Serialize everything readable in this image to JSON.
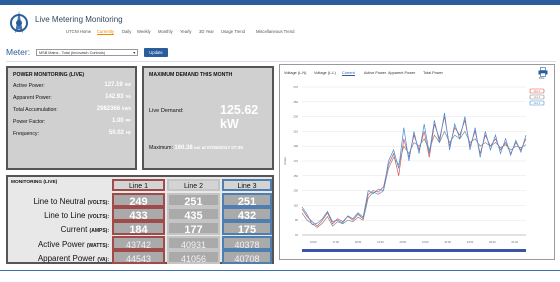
{
  "app": {
    "title": "Live Metering Monitoring"
  },
  "nav": {
    "items": [
      {
        "label": "UTCNI Home",
        "active": false
      },
      {
        "label": "Currently",
        "active": true
      },
      {
        "label": "Daily",
        "active": false
      },
      {
        "label": "Weekly",
        "active": false
      },
      {
        "label": "Monthly",
        "active": false
      },
      {
        "label": "Yearly",
        "active": false
      },
      {
        "label": "3D Year",
        "active": false
      },
      {
        "label": "Usage Trend",
        "active": false
      },
      {
        "label": "Miscellaneous Trend",
        "active": false
      }
    ]
  },
  "meter": {
    "label": "Meter:",
    "selected": "MSB Mains - Total (Innovatch Controls)",
    "update_label": "Update"
  },
  "power_monitoring": {
    "title": "POWER MONITORING (LIVE)",
    "rows": [
      {
        "label": "Active Power:",
        "value": "127.19",
        "unit": "kW"
      },
      {
        "label": "Apparent Power:",
        "value": "142.93",
        "unit": "VA"
      },
      {
        "label": "Total Accumulation:",
        "value": "2982366",
        "unit": "kWh"
      },
      {
        "label": "Power Factor:",
        "value": "1.00",
        "unit": "PF"
      },
      {
        "label": "Frequency:",
        "value": "50.02",
        "unit": "Hz"
      }
    ]
  },
  "max_demand": {
    "title": "MAXIMUM DEMAND THIS MONTH",
    "live_label": "Live Demand:",
    "live_value": "125.62 kW",
    "max_label": "Maximum:",
    "max_value": "160.38",
    "max_unit": "kW",
    "max_at": "at 07/09/2017 07:35"
  },
  "monitoring": {
    "title": "MONITORING (LIVE)",
    "columns": [
      "Line 1",
      "Line 2",
      "Line 3"
    ],
    "rows": [
      {
        "label": "Line to Neutral",
        "unit": "(VOLTS):",
        "values": [
          "249",
          "251",
          "251"
        ]
      },
      {
        "label": "Line to Line",
        "unit": "(VOLTS):",
        "values": [
          "433",
          "435",
          "432"
        ]
      },
      {
        "label": "Current",
        "unit": "(AMPS):",
        "values": [
          "184",
          "177",
          "175"
        ]
      },
      {
        "label": "Active Power",
        "unit": "(WATTS):",
        "values": [
          "43742",
          "40931",
          "40378"
        ]
      },
      {
        "label": "Apparent Power",
        "unit": "(VA):",
        "values": [
          "44543",
          "41056",
          "40708"
        ]
      }
    ]
  },
  "chart_tabs": {
    "items": [
      {
        "label": "Voltage (L-N)",
        "active": false
      },
      {
        "label": "Voltage (L-L)",
        "active": false
      },
      {
        "label": "Current",
        "active": true
      },
      {
        "label": "Active Power",
        "active": false
      },
      {
        "label": "Apparent Power",
        "active": false
      },
      {
        "label": "Total Power",
        "active": false
      }
    ],
    "print_label": "Print"
  },
  "colors": {
    "brand": "#2a5d9c",
    "nav_active": "#f08a00",
    "line1": "#d9534f",
    "line2": "#888888",
    "line3": "#3c8dde"
  },
  "chart_data": {
    "type": "line",
    "ylabel": "Amps",
    "ylim": [
      70,
      270
    ],
    "yticks": [
      "270",
      "250",
      "230",
      "210",
      "190",
      "170",
      "150",
      "130",
      "110",
      "90",
      "70"
    ],
    "xticks": [
      "16:00",
      "17:00",
      "18:00",
      "19:00",
      "20:00",
      "21:00",
      "22:00",
      "23:00",
      "00:00",
      "01:00"
    ],
    "legend": [
      "Line 1",
      "Line 2",
      "Line 3"
    ],
    "legend_placement": "top-right",
    "grid": true,
    "series": [
      {
        "name": "Line 1",
        "values": [
          105,
          95,
          88,
          82,
          90,
          100,
          85,
          92,
          88,
          95,
          90,
          98,
          92,
          125,
          130,
          128,
          135,
          165,
          180,
          150,
          200,
          175,
          205,
          185,
          210,
          175,
          220,
          200,
          230,
          190,
          215,
          205,
          225,
          190,
          210,
          180,
          205,
          190,
          200,
          185,
          195,
          180,
          195,
          185,
          200
        ]
      },
      {
        "name": "Line 2",
        "values": [
          100,
          90,
          85,
          80,
          86,
          95,
          82,
          88,
          85,
          90,
          88,
          94,
          90,
          120,
          128,
          125,
          130,
          160,
          175,
          165,
          190,
          180,
          195,
          190,
          200,
          185,
          205,
          195,
          210,
          195,
          205,
          200,
          210,
          195,
          200,
          190,
          195,
          190,
          195,
          188,
          192,
          185,
          190,
          188,
          192
        ]
      },
      {
        "name": "Line 3",
        "values": [
          108,
          98,
          84,
          86,
          92,
          102,
          88,
          90,
          86,
          96,
          92,
          100,
          94,
          130,
          126,
          132,
          130,
          170,
          185,
          160,
          215,
          170,
          210,
          180,
          220,
          180,
          225,
          195,
          235,
          185,
          220,
          200,
          230,
          185,
          215,
          175,
          210,
          185,
          205,
          180,
          200,
          178,
          198,
          182,
          205
        ]
      }
    ]
  }
}
